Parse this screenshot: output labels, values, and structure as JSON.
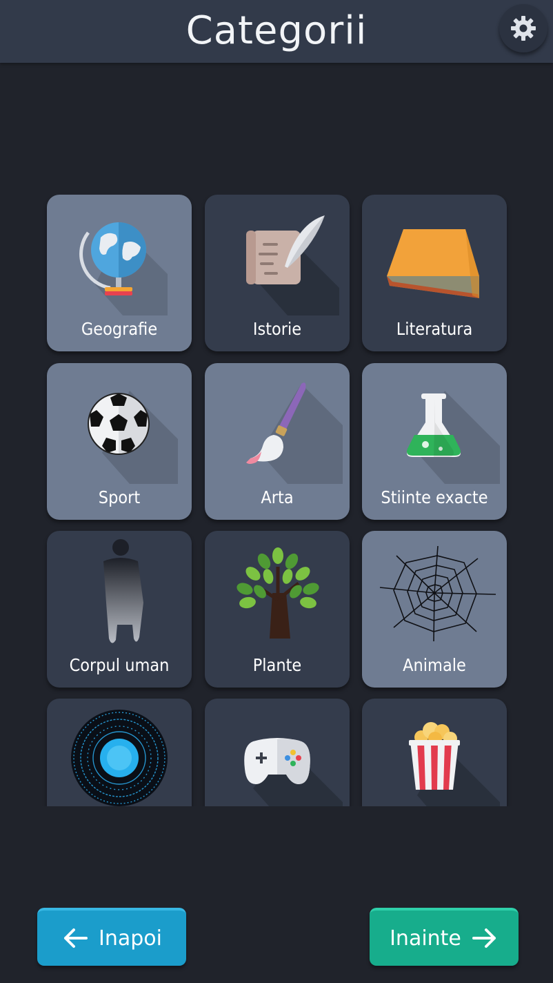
{
  "header": {
    "title": "Categorii",
    "settings_icon": "gear-icon"
  },
  "categories": [
    {
      "label": "Geografie",
      "icon": "globe-icon",
      "style": "light"
    },
    {
      "label": "Istorie",
      "icon": "scroll-quill-icon",
      "style": "dark"
    },
    {
      "label": "Literatura",
      "icon": "book-icon",
      "style": "dark"
    },
    {
      "label": "Sport",
      "icon": "soccer-ball-icon",
      "style": "light"
    },
    {
      "label": "Arta",
      "icon": "paintbrush-icon",
      "style": "light"
    },
    {
      "label": "Stiinte exacte",
      "icon": "flask-icon",
      "style": "light"
    },
    {
      "label": "Corpul uman",
      "icon": "human-silhouette-icon",
      "style": "dark"
    },
    {
      "label": "Plante",
      "icon": "tree-icon",
      "style": "dark"
    },
    {
      "label": "Animale",
      "icon": "spider-web-icon",
      "style": "light"
    },
    {
      "label": "",
      "icon": "cosmic-eye-icon",
      "style": "dark"
    },
    {
      "label": "",
      "icon": "gamepad-icon",
      "style": "dark"
    },
    {
      "label": "",
      "icon": "popcorn-icon",
      "style": "dark"
    }
  ],
  "footer": {
    "back_label": "Inapoi",
    "next_label": "Inainte"
  },
  "colors": {
    "background": "#20232b",
    "header": "#323a4a",
    "tile_light": "#6f7c92",
    "tile_dark": "#343c4c",
    "back_button": "#1b9dcb",
    "next_button": "#17ad8c"
  }
}
